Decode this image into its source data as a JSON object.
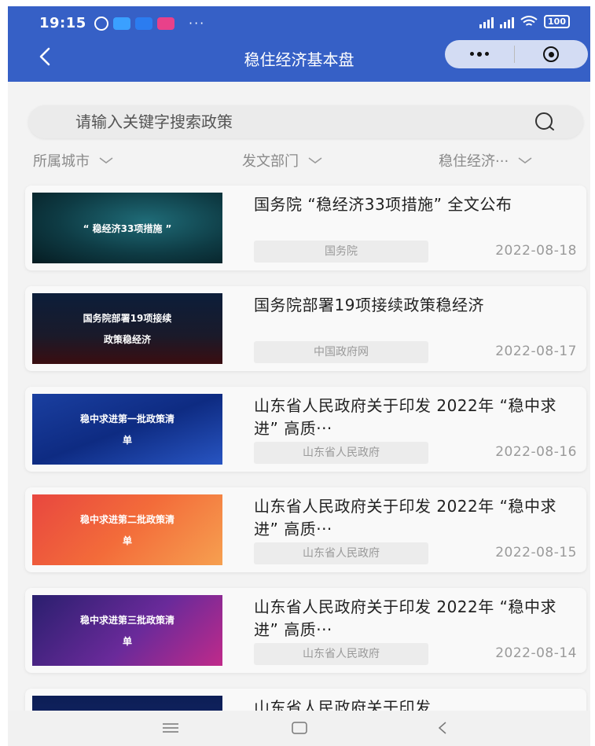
{
  "status_bar": {
    "time": "19:15",
    "dots": "···",
    "battery": "100",
    "icon_colors": [
      "#3aa0ff",
      "#2b7cf0",
      "#e8418a"
    ]
  },
  "header": {
    "title": "稳住经济基本盘",
    "background": "#3660c6"
  },
  "search": {
    "placeholder": "请输入关键字搜索政策"
  },
  "filters": [
    {
      "label": "所属城市"
    },
    {
      "label": "发文部门"
    },
    {
      "label": "稳住经济···"
    }
  ],
  "items": [
    {
      "thumb_text": [
        "“ 稳经济33项措施 ”"
      ],
      "title": "国务院 “稳经济33项措施” 全文公布",
      "source": "国务院",
      "date": "2022-08-18"
    },
    {
      "thumb_text": [
        "国务院部署19项接续",
        "政策稳经济"
      ],
      "title": "国务院部署19项接续政策稳经济",
      "source": "中国政府网",
      "date": "2022-08-17"
    },
    {
      "thumb_text": [
        "稳中求进第一批政策清",
        "单"
      ],
      "title": "山东省人民政府关于印发 2022年 “稳中求进” 高质···",
      "source": "山东省人民政府",
      "date": "2022-08-16"
    },
    {
      "thumb_text": [
        "稳中求进第二批政策清",
        "单"
      ],
      "title": "山东省人民政府关于印发 2022年 “稳中求进” 高质···",
      "source": "山东省人民政府",
      "date": "2022-08-15"
    },
    {
      "thumb_text": [
        "稳中求进第三批政策清",
        "单"
      ],
      "title": "山东省人民政府关于印发 2022年 “稳中求进” 高质···",
      "source": "山东省人民政府",
      "date": "2022-08-14"
    },
    {
      "thumb_text": [
        ""
      ],
      "title": "山东省人民政府关于印发",
      "source": "",
      "date": ""
    }
  ]
}
